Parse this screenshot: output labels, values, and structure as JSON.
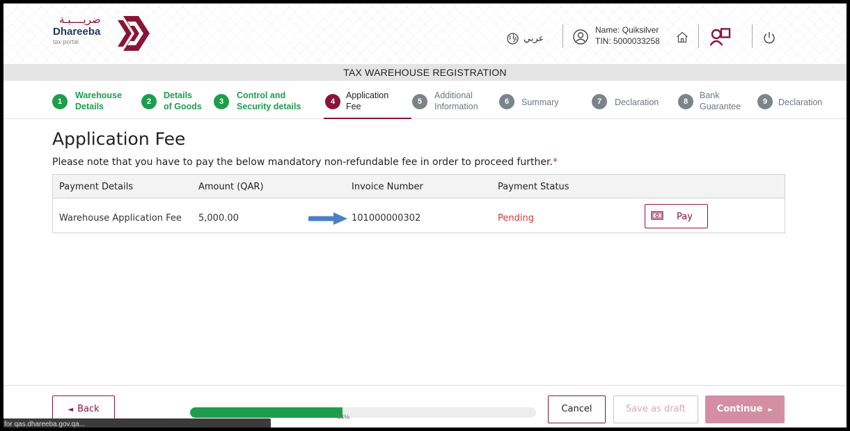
{
  "header": {
    "logo_arabic": "ضريــــبـة",
    "logo_name": "Dhareeba",
    "logo_sub": "tax portal",
    "language_toggle": "عربي",
    "user_name": "Name: Quiksilver",
    "user_tin": "TIN: 5000033258",
    "icons": [
      "globe-icon",
      "user-circle-icon",
      "home-icon",
      "users-icon",
      "power-icon"
    ]
  },
  "title_bar": "TAX WAREHOUSE REGISTRATION",
  "stepper": {
    "steps": [
      {
        "num": "1",
        "line1": "Warehouse",
        "line2": "Details",
        "state": "done"
      },
      {
        "num": "2",
        "line1": "Details",
        "line2": "of Goods",
        "state": "done"
      },
      {
        "num": "3",
        "line1": "Control and",
        "line2": "Security details",
        "state": "done"
      },
      {
        "num": "4",
        "line1": "Application",
        "line2": "Fee",
        "state": "active"
      },
      {
        "num": "5",
        "line1": "Additional",
        "line2": "Information",
        "state": "todo"
      },
      {
        "num": "6",
        "line1": "Summary",
        "line2": "",
        "state": "todo"
      },
      {
        "num": "7",
        "line1": "Declaration",
        "line2": "",
        "state": "todo"
      },
      {
        "num": "8",
        "line1": "Bank",
        "line2": "Guarantee",
        "state": "todo"
      },
      {
        "num": "9",
        "line1": "Declaration",
        "line2": "",
        "state": "todo"
      }
    ]
  },
  "main": {
    "title": "Application Fee",
    "note": "Please note that you have to pay the below mandatory non-refundable fee in order to proceed further.",
    "note_required": "*",
    "table": {
      "headers": [
        "Payment Details",
        "Amount (QAR)",
        "Invoice Number",
        "Payment Status"
      ],
      "rows": [
        {
          "payment_details": "Warehouse Application Fee",
          "amount": "5,000.00",
          "invoice": "101000000302",
          "status": "Pending",
          "action": "Pay"
        }
      ]
    }
  },
  "footer": {
    "back_label": "Back",
    "progress_value": 44,
    "progress_text": "44%",
    "cancel_label": "Cancel",
    "draft_label": "Save as draft",
    "continue_label": "Continue"
  },
  "status_bar": "for qas.dhareeba.gov.qa...",
  "colors": {
    "brand": "#8a1538",
    "done": "#1e9d4d",
    "todo": "#7b8489",
    "pending": "#d9363e",
    "continue_bg": "#d38ea4"
  }
}
